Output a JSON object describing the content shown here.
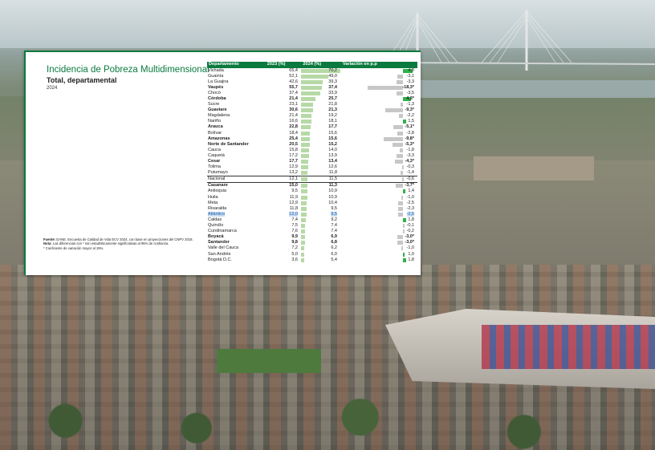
{
  "panel": {
    "title": "Incidencia de Pobreza Multidimensional",
    "subtitle": "Total, departamental",
    "year": "2024",
    "notes": {
      "fuente_label": "Fuente:",
      "fuente": "DANE. Encuesta de Calidad de Vida ECV 2024, con base en proyecciones del CNPV 2018.",
      "nota_label": "Nota:",
      "nota": "Las diferencias con * son estadísticamente significativas al 95% de confianza.",
      "cv": "* Coeficiente de variación mayor al 15%."
    }
  },
  "table": {
    "headers": [
      "Departamento",
      "2023 (%)",
      "2024 (%)",
      "Variación en p.p"
    ],
    "rows": [
      {
        "name": "Vichada",
        "v2023": "65,4",
        "v2024": "70,2",
        "var": "4,8",
        "n24": 70.2,
        "nvar": 4.8
      },
      {
        "name": "Guainía",
        "v2023": "52,1",
        "v2024": "49,0",
        "var": "-3,1",
        "n24": 49.0,
        "nvar": -3.1
      },
      {
        "name": "La Guajira",
        "v2023": "42,6",
        "v2024": "39,3",
        "var": "-3,3",
        "n24": 39.3,
        "nvar": -3.3
      },
      {
        "name": "Vaupés",
        "v2023": "55,7",
        "v2024": "37,4",
        "var": "-18,3*",
        "n24": 37.4,
        "nvar": -18.3,
        "bold": true
      },
      {
        "name": "Chocó",
        "v2023": "37,4",
        "v2024": "33,9",
        "var": "-3,5",
        "n24": 33.9,
        "nvar": -3.5
      },
      {
        "name": "Córdoba",
        "v2023": "21,4",
        "v2024": "25,7",
        "var": "4,3*",
        "n24": 25.7,
        "nvar": 4.3,
        "bold": true
      },
      {
        "name": "Sucre",
        "v2023": "23,1",
        "v2024": "21,8",
        "var": "-1,3",
        "n24": 21.8,
        "nvar": -1.3
      },
      {
        "name": "Guaviare",
        "v2023": "30,6",
        "v2024": "21,3",
        "var": "-9,3*",
        "n24": 21.3,
        "nvar": -9.3,
        "bold": true
      },
      {
        "name": "Magdalena",
        "v2023": "21,4",
        "v2024": "19,2",
        "var": "-2,2",
        "n24": 19.2,
        "nvar": -2.2
      },
      {
        "name": "Nariño",
        "v2023": "16,6",
        "v2024": "18,1",
        "var": "1,5",
        "n24": 18.1,
        "nvar": 1.5
      },
      {
        "name": "Arauca",
        "v2023": "22,8",
        "v2024": "17,7",
        "var": "-5,1*",
        "n24": 17.7,
        "nvar": -5.1,
        "bold": true
      },
      {
        "name": "Bolívar",
        "v2023": "18,4",
        "v2024": "15,6",
        "var": "-2,8",
        "n24": 15.6,
        "nvar": -2.8
      },
      {
        "name": "Amazonas",
        "v2023": "25,4",
        "v2024": "15,6",
        "var": "-9,8*",
        "n24": 15.6,
        "nvar": -9.8,
        "bold": true
      },
      {
        "name": "Norte de Santander",
        "v2023": "20,5",
        "v2024": "15,2",
        "var": "-5,3*",
        "n24": 15.2,
        "nvar": -5.3,
        "bold": true
      },
      {
        "name": "Cauca",
        "v2023": "15,8",
        "v2024": "14,0",
        "var": "-1,8",
        "n24": 14.0,
        "nvar": -1.8
      },
      {
        "name": "Caquetá",
        "v2023": "17,2",
        "v2024": "13,9",
        "var": "-3,3",
        "n24": 13.9,
        "nvar": -3.3
      },
      {
        "name": "Cesar",
        "v2023": "17,7",
        "v2024": "13,4",
        "var": "-4,3*",
        "n24": 13.4,
        "nvar": -4.3,
        "bold": true
      },
      {
        "name": "Tolima",
        "v2023": "12,9",
        "v2024": "12,6",
        "var": "-0,3",
        "n24": 12.6,
        "nvar": -0.3
      },
      {
        "name": "Putumayo",
        "v2023": "13,2",
        "v2024": "11,8",
        "var": "-1,4",
        "n24": 11.8,
        "nvar": -1.4
      },
      {
        "name": "Nacional",
        "v2023": "12,1",
        "v2024": "11,5",
        "var": "-0,6",
        "n24": 11.5,
        "nvar": -0.6,
        "sep": true
      },
      {
        "name": "Casanare",
        "v2023": "15,0",
        "v2024": "11,3",
        "var": "-3,7*",
        "n24": 11.3,
        "nvar": -3.7,
        "bold": true,
        "sep": true
      },
      {
        "name": "Antioquia",
        "v2023": "9,5",
        "v2024": "10,9",
        "var": "1,4",
        "n24": 10.9,
        "nvar": 1.4
      },
      {
        "name": "Huila",
        "v2023": "11,9",
        "v2024": "10,9",
        "var": "-1,0",
        "n24": 10.9,
        "nvar": -1.0
      },
      {
        "name": "Meta",
        "v2023": "12,9",
        "v2024": "10,4",
        "var": "-2,5",
        "n24": 10.4,
        "nvar": -2.5
      },
      {
        "name": "Risaralda",
        "v2023": "11,8",
        "v2024": "9,5",
        "var": "-2,3",
        "n24": 9.5,
        "nvar": -2.3
      },
      {
        "name": "Atlántico",
        "v2023": "12,0",
        "v2024": "9,5",
        "var": "-2,5",
        "n24": 9.5,
        "nvar": -2.5,
        "highlight": true
      },
      {
        "name": "Caldas",
        "v2023": "7,4",
        "v2024": "9,2",
        "var": "1,8",
        "n24": 9.2,
        "nvar": 1.8
      },
      {
        "name": "Quindío",
        "v2023": "7,5",
        "v2024": "7,4",
        "var": "-0,1",
        "n24": 7.4,
        "nvar": -0.1
      },
      {
        "name": "Cundinamarca",
        "v2023": "7,6",
        "v2024": "7,4",
        "var": "-0,2",
        "n24": 7.4,
        "nvar": -0.2
      },
      {
        "name": "Boyacá",
        "v2023": "9,9",
        "v2024": "6,9",
        "var": "-3,0*",
        "n24": 6.9,
        "nvar": -3.0,
        "bold": true
      },
      {
        "name": "Santander",
        "v2023": "9,8",
        "v2024": "6,8",
        "var": "-3,0*",
        "n24": 6.8,
        "nvar": -3.0,
        "bold": true
      },
      {
        "name": "Valle del Cauca",
        "v2023": "7,2",
        "v2024": "6,2",
        "var": "-1,0",
        "n24": 6.2,
        "nvar": -1.0
      },
      {
        "name": "San Andrés",
        "v2023": "5,0",
        "v2024": "6,0",
        "var": "1,0",
        "n24": 6.0,
        "nvar": 1.0
      },
      {
        "name": "Bogotá D.C.",
        "v2023": "3,6",
        "v2024": "5,4",
        "var": "1,8",
        "n24": 5.4,
        "nvar": 1.8
      }
    ]
  }
}
